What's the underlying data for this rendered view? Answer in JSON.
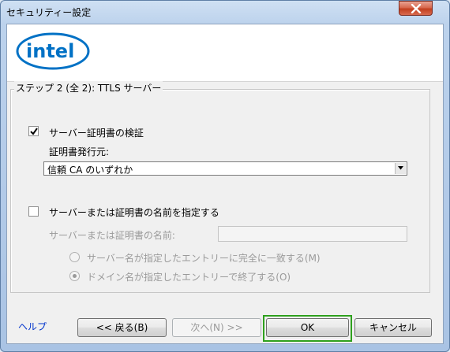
{
  "window": {
    "title": "セキュリティー設定"
  },
  "brand": {
    "logo_text": "intel",
    "logo_color": "#0071c5"
  },
  "step": {
    "group_label": "ステップ 2 (全 2): TTLS サーバー"
  },
  "server_cert_validation": {
    "checkbox_label": "サーバー証明書の検証",
    "checked": true,
    "issuer_label": "証明書発行元:",
    "issuer_selected": "信頼 CA のいずれか"
  },
  "server_name": {
    "checkbox_label": "サーバーまたは証明書の名前を指定する",
    "checked": false,
    "name_label": "サーバーまたは証明書の名前:",
    "name_value": "",
    "options": [
      {
        "label": "サーバー名が指定したエントリーに完全に一致する(M)",
        "selected": false
      },
      {
        "label": "ドメイン名が指定したエントリーで終了する(O)",
        "selected": true
      }
    ]
  },
  "footer": {
    "help_label": "ヘルプ",
    "back_label": "<< 戻る(B)",
    "next_label": "次へ(N) >>",
    "ok_label": "OK",
    "cancel_label": "キャンセル"
  },
  "colors": {
    "highlight": "#2fa11e",
    "link": "#0033cc"
  }
}
